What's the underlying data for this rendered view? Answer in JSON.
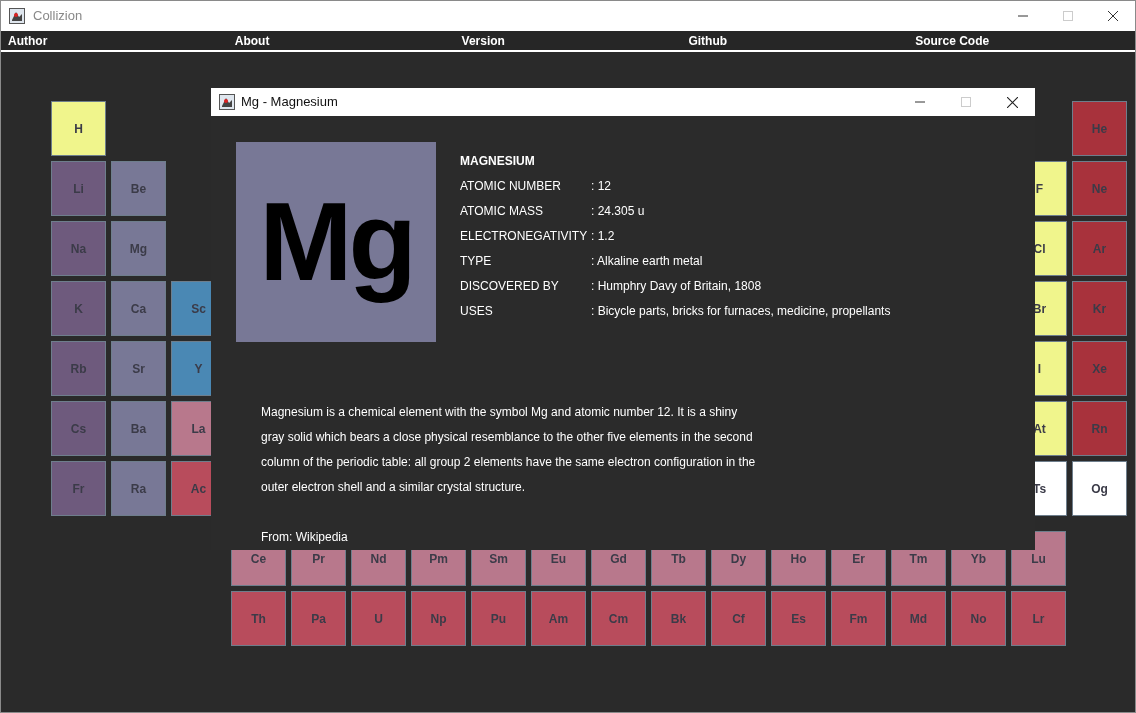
{
  "window": {
    "title": "Collizion"
  },
  "menu": [
    {
      "label": "Author"
    },
    {
      "label": "About"
    },
    {
      "label": "Version"
    },
    {
      "label": "Github"
    },
    {
      "label": "Source Code"
    }
  ],
  "periodic_table": {
    "rows": [
      {
        "left": [
          {
            "symbol": "H",
            "color": "#f0f58c"
          }
        ],
        "right": [
          {
            "symbol": "He",
            "color": "#a8323c"
          }
        ]
      },
      {
        "left": [
          {
            "symbol": "Li",
            "color": "#6e5a7d"
          },
          {
            "symbol": "Be",
            "color": "#787896"
          }
        ],
        "right": [
          {
            "symbol": "F",
            "color": "#f0f58c"
          },
          {
            "symbol": "Ne",
            "color": "#a8323c"
          }
        ]
      },
      {
        "left": [
          {
            "symbol": "Na",
            "color": "#6e5a7d"
          },
          {
            "symbol": "Mg",
            "color": "#787896"
          }
        ],
        "right": [
          {
            "symbol": "Cl",
            "color": "#f0f58c"
          },
          {
            "symbol": "Ar",
            "color": "#a8323c"
          }
        ]
      },
      {
        "left": [
          {
            "symbol": "K",
            "color": "#6e5a7d"
          },
          {
            "symbol": "Ca",
            "color": "#787896"
          },
          {
            "symbol": "Sc",
            "color": "#4a88b4"
          }
        ],
        "right": [
          {
            "symbol": "Br",
            "color": "#f0f58c"
          },
          {
            "symbol": "Kr",
            "color": "#a8323c"
          }
        ]
      },
      {
        "left": [
          {
            "symbol": "Rb",
            "color": "#6e5a7d"
          },
          {
            "symbol": "Sr",
            "color": "#787896"
          },
          {
            "symbol": "Y",
            "color": "#4a88b4"
          }
        ],
        "right": [
          {
            "symbol": "I",
            "color": "#f0f58c"
          },
          {
            "symbol": "Xe",
            "color": "#a8323c"
          }
        ]
      },
      {
        "left": [
          {
            "symbol": "Cs",
            "color": "#6e5a7d"
          },
          {
            "symbol": "Ba",
            "color": "#787896"
          },
          {
            "symbol": "La",
            "color": "#b8788c"
          }
        ],
        "right": [
          {
            "symbol": "At",
            "color": "#f0f58c"
          },
          {
            "symbol": "Rn",
            "color": "#a8323c"
          }
        ]
      },
      {
        "left": [
          {
            "symbol": "Fr",
            "color": "#6e5a7d"
          },
          {
            "symbol": "Ra",
            "color": "#787896"
          },
          {
            "symbol": "Ac",
            "color": "#b84c5c"
          }
        ],
        "right": [
          {
            "symbol": "Ts",
            "color": "#ffffff"
          },
          {
            "symbol": "Og",
            "color": "#ffffff"
          }
        ]
      }
    ],
    "f_rows": [
      [
        {
          "symbol": "Ce",
          "color": "#b8788c"
        },
        {
          "symbol": "Pr",
          "color": "#b8788c"
        },
        {
          "symbol": "Nd",
          "color": "#b8788c"
        },
        {
          "symbol": "Pm",
          "color": "#b8788c"
        },
        {
          "symbol": "Sm",
          "color": "#b8788c"
        },
        {
          "symbol": "Eu",
          "color": "#b8788c"
        },
        {
          "symbol": "Gd",
          "color": "#b8788c"
        },
        {
          "symbol": "Tb",
          "color": "#b8788c"
        },
        {
          "symbol": "Dy",
          "color": "#b8788c"
        },
        {
          "symbol": "Ho",
          "color": "#b8788c"
        },
        {
          "symbol": "Er",
          "color": "#b8788c"
        },
        {
          "symbol": "Tm",
          "color": "#b8788c"
        },
        {
          "symbol": "Yb",
          "color": "#b8788c"
        },
        {
          "symbol": "Lu",
          "color": "#b8788c"
        }
      ],
      [
        {
          "symbol": "Th",
          "color": "#b84c5c"
        },
        {
          "symbol": "Pa",
          "color": "#b84c5c"
        },
        {
          "symbol": "U",
          "color": "#b84c5c"
        },
        {
          "symbol": "Np",
          "color": "#b84c5c"
        },
        {
          "symbol": "Pu",
          "color": "#b84c5c"
        },
        {
          "symbol": "Am",
          "color": "#b84c5c"
        },
        {
          "symbol": "Cm",
          "color": "#b84c5c"
        },
        {
          "symbol": "Bk",
          "color": "#b84c5c"
        },
        {
          "symbol": "Cf",
          "color": "#b84c5c"
        },
        {
          "symbol": "Es",
          "color": "#b84c5c"
        },
        {
          "symbol": "Fm",
          "color": "#b84c5c"
        },
        {
          "symbol": "Md",
          "color": "#b84c5c"
        },
        {
          "symbol": "No",
          "color": "#b84c5c"
        },
        {
          "symbol": "Lr",
          "color": "#b84c5c"
        }
      ]
    ]
  },
  "dialog": {
    "title": "Mg - Magnesium",
    "symbol": "Mg",
    "name": "MAGNESIUM",
    "properties": [
      {
        "label": "ATOMIC NUMBER",
        "value": ": 12"
      },
      {
        "label": "ATOMIC MASS",
        "value": ": 24.305 u"
      },
      {
        "label": "ELECTRONEGATIVITY",
        "value": ": 1.2"
      },
      {
        "label": "TYPE",
        "value": ": Alkaline earth metal"
      },
      {
        "label": "DISCOVERED BY",
        "value": ": Humphry Davy of Britain, 1808"
      },
      {
        "label": "USES",
        "value": ": Bicycle parts, bricks for furnaces, medicine, propellants"
      }
    ],
    "description": "Magnesium is a chemical element with the symbol Mg and atomic number 12. It is a shiny gray solid which bears a close physical resemblance to the other five elements in the second column of the periodic table: all group 2 elements have the same electron configuration in the outer electron shell and a similar crystal structure.",
    "source": "From: Wikipedia"
  }
}
